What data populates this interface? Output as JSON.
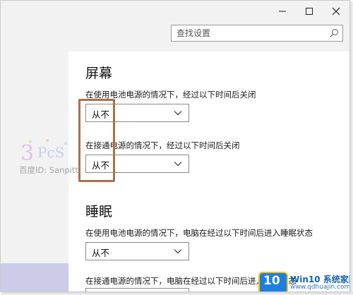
{
  "search": {
    "placeholder": "查找设置"
  },
  "screen_section": {
    "heading": "屏幕",
    "battery_label": "在使用电池电源的情况下，经过以下时间后关闭",
    "battery_value": "从不",
    "plugged_label": "在接通电源的情况下，经过以下时间后关闭",
    "plugged_value": "从不"
  },
  "sleep_section": {
    "heading": "睡眠",
    "battery_label": "在使用电池电源的情况下，电脑在经过以下时间后进入睡眠状态",
    "battery_value": "从不",
    "plugged_label": "在接通电源的情况下，电脑在经过以下时间后进入睡眠状态"
  },
  "watermark": {
    "text": "百度ID: Sanpitt"
  },
  "site_badge": {
    "title": "Win10 系统家园",
    "url": "www.qdhuajin.com",
    "logo_text": "10"
  },
  "colors": {
    "highlight": "#a9714a",
    "sidebar_selected": "#cccce8",
    "badge_blue": "#1665b5"
  }
}
